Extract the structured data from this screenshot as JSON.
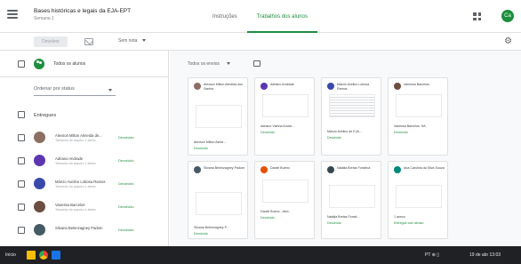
{
  "header": {
    "title": "Bases históricas e legais da EJA-EPT",
    "subtitle": "Semana 1",
    "tabs": [
      "Instruções",
      "Trabalhos dos alunos"
    ],
    "avatar_letter": "Ca"
  },
  "toolbar": {
    "return_label": "Devolver",
    "points_label": "Sem nota",
    "settings_glyph": "⚙"
  },
  "left": {
    "all_students_label": "Todos os alunos",
    "sort_label": "Ordenar por status",
    "section_label": "Entregues",
    "students": [
      {
        "name": "Alexson Milton Almeida de...",
        "sub": "Tamanho do arquivo 1 alerta",
        "status": "Devolvido"
      },
      {
        "name": "Adriano Andrade",
        "sub": "Tamanho do arquivo 1 alerta",
        "status": "Devolvido"
      },
      {
        "name": "Márcio Avelino Lobosa Ramos",
        "sub": "Tamanho do arquivo 1 alerta",
        "status": "Devolvido"
      },
      {
        "name": "Vanessa Barcelos",
        "sub": "Tamanho do arquivo 1 alerta",
        "status": "Devolvido"
      },
      {
        "name": "Silvana Belenzagney Padom",
        "sub": "",
        "status": "Devolvido"
      }
    ]
  },
  "right": {
    "filter_label": "Todos os envios",
    "cards": [
      {
        "name": "Alexson Milton Almeida dos Santos",
        "file": "Alexson Milton Almei...",
        "status": "Devolvido"
      },
      {
        "name": "Adriano Andrade",
        "file": "Adriano Vianna Andra...",
        "status": "Devolvido"
      },
      {
        "name": "Márcio Avelino Lobosa Ramos",
        "file": "Márcio Avelino de EJA...",
        "status": "Devolvido"
      },
      {
        "name": "Vanessa Barcelos",
        "file": "Vanessa Barcelos: HA",
        "status": "Devolvido"
      },
      {
        "name": "Silvana Belenzagney Padom",
        "file": "Silvana Belenzagney P...",
        "status": "Devolvido"
      },
      {
        "name": "Daniel Bueno",
        "file": "Daniel Bueno - Ativi...",
        "status": "Devolvido"
      },
      {
        "name": "Natália Bretas Fonsêca",
        "file": "Natália Bretas Fonsê...",
        "status": "Devolvido"
      },
      {
        "name": "Ana Carolina da Silva Souza",
        "file": "1 anexo",
        "status": "Entregue com atraso"
      }
    ]
  },
  "taskbar": {
    "start_label": "Início",
    "tray_text": "PT  ⊕  ▯",
    "time_text": "19 de abr 13:03"
  },
  "colors": {
    "accent": "#1e8e3e",
    "text": "#3c4043",
    "taskbar": "#202124"
  }
}
